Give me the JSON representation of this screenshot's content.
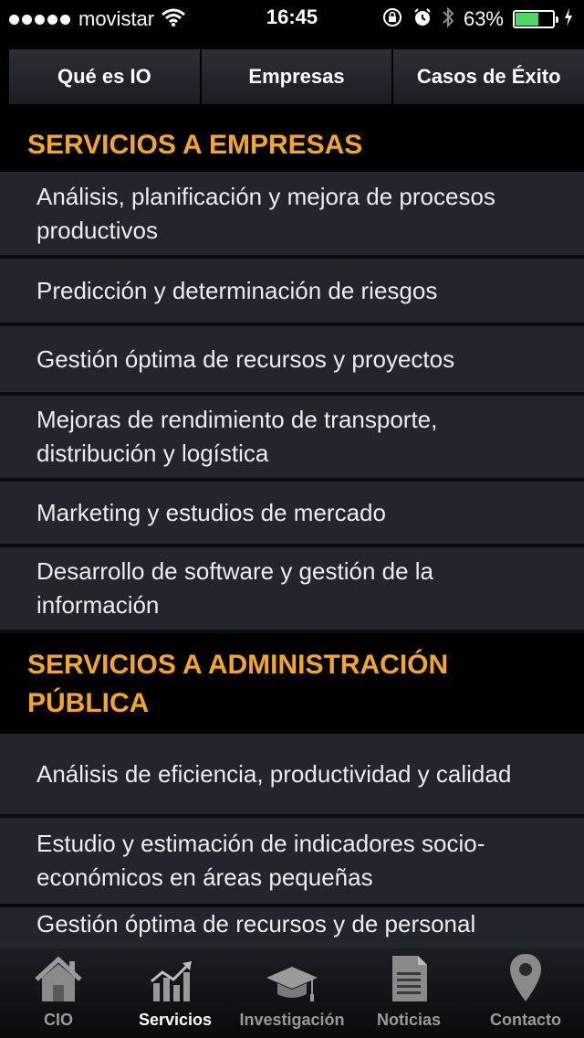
{
  "status_bar": {
    "carrier": "movistar",
    "time": "16:45",
    "battery_percent_label": "63%",
    "battery_level": 0.63,
    "battery_color": "#4cd964"
  },
  "top_tabs": [
    {
      "label": "Qué es IO"
    },
    {
      "label": "Empresas"
    },
    {
      "label": "Casos de Éxito"
    }
  ],
  "sections": [
    {
      "title": "SERVICIOS A EMPRESAS",
      "items": [
        "Análisis, planificación y mejora de procesos productivos",
        "Predicción y determinación de riesgos",
        "Gestión óptima de recursos y proyectos",
        "Mejoras de rendimiento de transporte, distribución y logística",
        "Marketing y estudios de mercado",
        "Desarrollo de software y gestión de la información"
      ]
    },
    {
      "title": "SERVICIOS A ADMINISTRACIÓN PÚBLICA",
      "items": [
        "Análisis de eficiencia, productividad y calidad",
        "Estudio y estimación de indicadores socio-económicos en áreas pequeñas",
        "Gestión óptima de recursos y de personal"
      ]
    }
  ],
  "tab_bar": [
    {
      "label": "CIO",
      "icon": "home-icon"
    },
    {
      "label": "Servicios",
      "icon": "chart-icon",
      "active": true
    },
    {
      "label": "Investigación",
      "icon": "graduation-cap-icon"
    },
    {
      "label": "Noticias",
      "icon": "document-icon"
    },
    {
      "label": "Contacto",
      "icon": "location-pin-icon"
    }
  ],
  "colors": {
    "accent": "#f5a623",
    "item_background": "#23252c",
    "background": "#000000"
  }
}
